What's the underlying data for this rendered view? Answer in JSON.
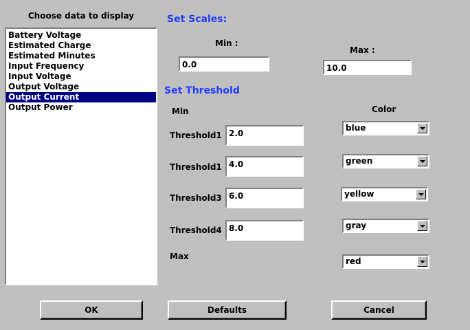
{
  "data_list": {
    "title": "Choose data to display",
    "items": [
      {
        "label": "Battery Voltage",
        "selected": false
      },
      {
        "label": "Estimated Charge",
        "selected": false
      },
      {
        "label": "Estimated Minutes",
        "selected": false
      },
      {
        "label": "Input Frequency",
        "selected": false
      },
      {
        "label": "Input Voltage",
        "selected": false
      },
      {
        "label": "Output Voltage",
        "selected": false
      },
      {
        "label": "Output Current",
        "selected": true
      },
      {
        "label": "Output Power",
        "selected": false
      }
    ]
  },
  "scales": {
    "title": "Set Scales:",
    "min_label": "Min :",
    "min_value": "0.0",
    "max_label": "Max :",
    "max_value": "10.0"
  },
  "threshold": {
    "title": "Set Threshold",
    "min_header": "Min",
    "color_header": "Color",
    "max_label": "Max",
    "rows": [
      {
        "label": "Threshold1",
        "value": "2.0",
        "color": "blue"
      },
      {
        "label": "Threshold1",
        "value": "4.0",
        "color": "green"
      },
      {
        "label": "Threshold3",
        "value": "6.0",
        "color": "yellow"
      },
      {
        "label": "Threshold4",
        "value": "8.0",
        "color": "gray"
      }
    ],
    "max_color": "red"
  },
  "buttons": {
    "ok": "OK",
    "defaults": "Defaults",
    "cancel": "Cancel"
  },
  "colors": {
    "section_title": "#1f3dff",
    "selection": "#000080",
    "background": "#c0c0c0"
  }
}
